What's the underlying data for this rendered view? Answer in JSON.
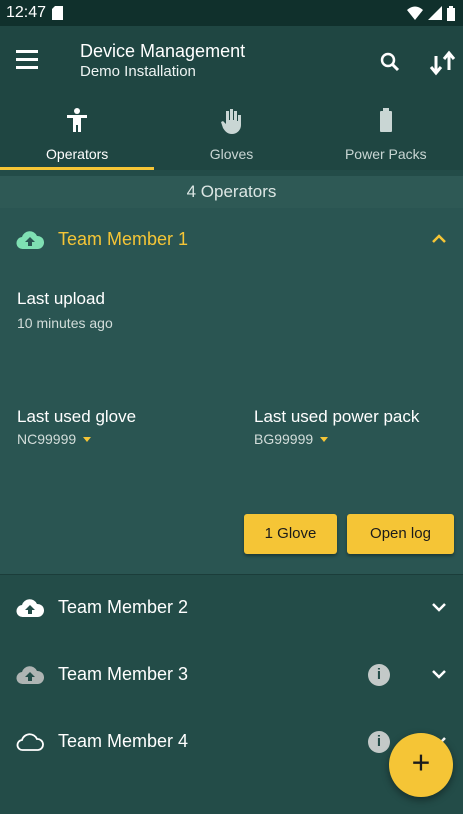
{
  "status": {
    "time": "12:47"
  },
  "appbar": {
    "title": "Device Management",
    "subtitle": "Demo Installation"
  },
  "tabs": [
    {
      "label": "Operators",
      "icon": "person-icon",
      "active": true
    },
    {
      "label": "Gloves",
      "icon": "glove-icon",
      "active": false
    },
    {
      "label": "Power Packs",
      "icon": "battery-icon",
      "active": false
    }
  ],
  "count_label": "4 Operators",
  "members": [
    {
      "name": "Team Member 1",
      "cloud_icon": "cloud-upload-filled-icon",
      "expanded": true,
      "last_upload_label": "Last upload",
      "last_upload_value": "10 minutes ago",
      "last_glove_label": "Last used glove",
      "last_glove_value": "NC99999",
      "last_pack_label": "Last used power pack",
      "last_pack_value": "BG99999",
      "glove_button": "1 Glove",
      "log_button": "Open log"
    },
    {
      "name": "Team Member 2",
      "cloud_icon": "cloud-upload-white-icon",
      "info": false
    },
    {
      "name": "Team Member 3",
      "cloud_icon": "cloud-upload-grey-icon",
      "info": true
    },
    {
      "name": "Team Member 4",
      "cloud_icon": "cloud-outline-icon",
      "info": true
    }
  ],
  "fab_label": "+",
  "colors": {
    "accent": "#f5c536",
    "background": "#234c48",
    "header": "#1f4642",
    "expanded": "#2a5552"
  }
}
